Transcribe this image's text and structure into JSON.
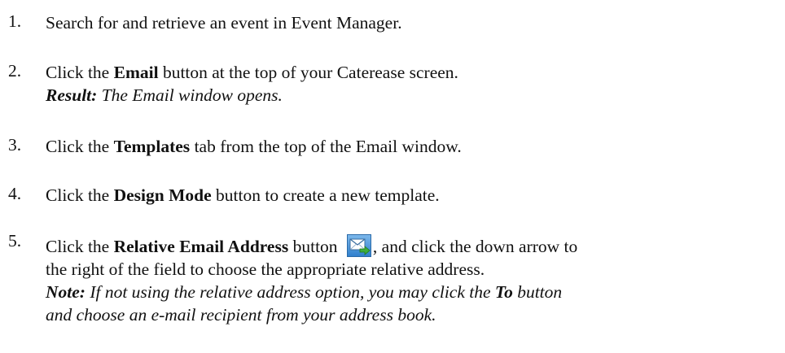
{
  "steps": [
    {
      "number": "1.",
      "text": "Search for and retrieve an event in Event Manager."
    },
    {
      "number": "2.",
      "pre": "Click the ",
      "bold": "Email",
      "post": " button at the top of your Caterease screen.",
      "result_label": "Result:",
      "result_text": " The Email window opens."
    },
    {
      "number": "3.",
      "pre": "Click the ",
      "bold": "Templates",
      "post": " tab from the top of the Email window."
    },
    {
      "number": "4.",
      "pre": "Click the ",
      "bold": "Design Mode",
      "post": " button to create a new template."
    },
    {
      "number": "5.",
      "pre": "Click the ",
      "bold": "Relative Email Address",
      "mid": " button ",
      "icon": "relative-email-address-icon",
      "post": ", and click the down arrow to",
      "line2": "the right of the field to choose the appropriate relative address.",
      "note_label": "Note:",
      "note_line1_pre": " If not using the relative address option, you may click the ",
      "note_bold": "To",
      "note_line1_post": " button",
      "note_line2": "and choose an e-mail recipient from your address book."
    }
  ]
}
